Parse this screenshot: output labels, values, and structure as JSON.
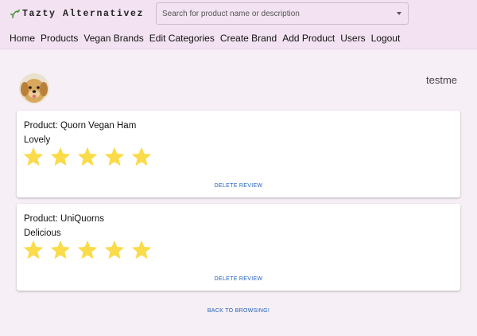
{
  "app": {
    "logo_text": "Tazty Alternativez",
    "search_placeholder": "Search for product name or description"
  },
  "nav": {
    "items": [
      "Home",
      "Products",
      "Vegan Brands",
      "Edit Categories",
      "Create Brand",
      "Add Product",
      "Users",
      "Logout"
    ]
  },
  "profile": {
    "username": "testme",
    "avatar_icon": "dog-avatar"
  },
  "reviews": [
    {
      "product": "Product: Quorn Vegan Ham",
      "text": "Lovely",
      "rating": 5,
      "max_rating": 5,
      "delete_label": "DELETE REVIEW"
    },
    {
      "product": "Product: UniQuorns",
      "text": "Delicious",
      "rating": 5,
      "max_rating": 5,
      "delete_label": "DELETE REVIEW"
    }
  ],
  "back_label": "BACK TO BROWSING!",
  "colors": {
    "header_bg": "#f3e3f2",
    "page_bg": "#f6eff5",
    "star": "#fadb4a",
    "button_text": "#1e60b8"
  }
}
